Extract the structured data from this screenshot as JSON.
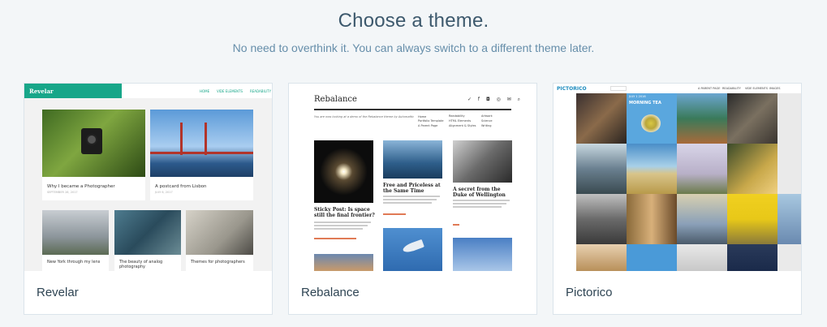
{
  "page": {
    "title": "Choose a theme.",
    "subtitle": "No need to overthink it. You can always switch to a different theme later."
  },
  "themes": [
    {
      "name": "Revelar",
      "preview": {
        "logo": "Revelar",
        "nav": [
          "HOME",
          "VIDE ELEMENTS",
          "READABILITY"
        ],
        "posts": [
          {
            "title": "Why I became a Photographer",
            "date": "SEPTEMBER 28, 2017"
          },
          {
            "title": "A postcard from Lisbon",
            "date": "JULY 6, 2017"
          },
          {
            "title": "New York through my lens"
          },
          {
            "title": "The beauty of analog photography"
          },
          {
            "title": "Themes for photographers"
          }
        ]
      }
    },
    {
      "name": "Rebalance",
      "preview": {
        "logo": "Rebalance",
        "tagline": "You are now looking at a demo of the Rebalance theme by Automattic",
        "menu_col1": [
          "Home",
          "Portfolio Template",
          "A Parent Page"
        ],
        "menu_col2": [
          "Readability",
          "HTML Elements",
          "Alignment & Styles"
        ],
        "menu_col3": [
          "Artwork",
          "Science",
          "Writing"
        ],
        "posts": [
          {
            "title": "Sticky Post: Is space still the final frontier?"
          },
          {
            "title": "Free and Priceless at the Same Time"
          },
          {
            "title": "A secret from the Duke of Wellington"
          }
        ]
      }
    },
    {
      "name": "Pictorico",
      "preview": {
        "logo": "PICTORICO",
        "nav": [
          "A PARENT PAGE",
          "READABILITY",
          "VIDE ELEMENTS",
          "IMAGES"
        ],
        "badge_date": "JULY 1 2016",
        "badge_title": "MORNING TEA"
      }
    }
  ]
}
